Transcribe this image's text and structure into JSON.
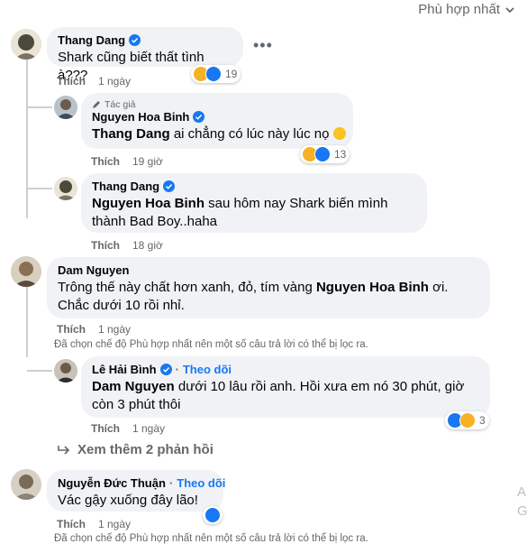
{
  "sort_label": "Phù hợp nhất",
  "colors": {
    "blue": "#1877f2",
    "bubble": "#f0f2f5",
    "meta": "#65676b"
  },
  "comments": {
    "c1": {
      "name": "Thang Dang",
      "text": "Shark cũng biết thất tình à???",
      "like": "Thích",
      "time": "1 ngày",
      "reaction_count": "19",
      "reactions": [
        "haha-icon",
        "like-icon"
      ]
    },
    "r1": {
      "author_badge": "Tác giả",
      "name": "Nguyen Hoa Binh",
      "mention": "Thang Dang",
      "text": " ai chẳng có lúc này lúc nọ",
      "like": "Thích",
      "time": "19 giờ",
      "reaction_count": "13",
      "reactions": [
        "haha-icon",
        "like-icon"
      ]
    },
    "r2": {
      "name": "Thang Dang",
      "mention": "Nguyen Hoa Binh",
      "text": " sau hôm nay Shark biến mình thành Bad Boy..haha",
      "like": "Thích",
      "time": "18 giờ"
    },
    "c2": {
      "name": "Dam Nguyen",
      "text1": "Trông thế này chất hơn xanh, đỏ, tím vàng ",
      "mention": "Nguyen Hoa Binh",
      "text2": " ơi. Chắc dưới 10 rồi nhỉ.",
      "like": "Thích",
      "time": "1 ngày",
      "note": "Đã chọn chế độ Phù hợp nhất nên một số câu trả lời có thể bị lọc ra."
    },
    "r3": {
      "name": "Lê Hải Bình",
      "follow_sep": "·",
      "follow": "Theo dõi",
      "mention": "Dam Nguyen",
      "text": " dưới 10 lâu rồi anh. Hồi xưa em nó 30 phút, giờ còn 3 phút thôi",
      "like": "Thích",
      "time": "1 ngày",
      "reaction_count": "3",
      "reactions": [
        "like-icon",
        "haha-icon"
      ]
    },
    "see_more": "Xem thêm 2 phản hồi",
    "c3": {
      "name": "Nguyễn Đức Thuận",
      "follow_sep": "·",
      "follow": "Theo dõi",
      "text": "Vác gậy xuống đây lão!",
      "like": "Thích",
      "time": "1 ngày",
      "reactions": [
        "like-icon"
      ],
      "note": "Đã chọn chế độ Phù hợp nhất nên một số câu trả lời có thể bị lọc ra."
    }
  },
  "edge_letters": {
    "a": "A",
    "g": "G"
  }
}
